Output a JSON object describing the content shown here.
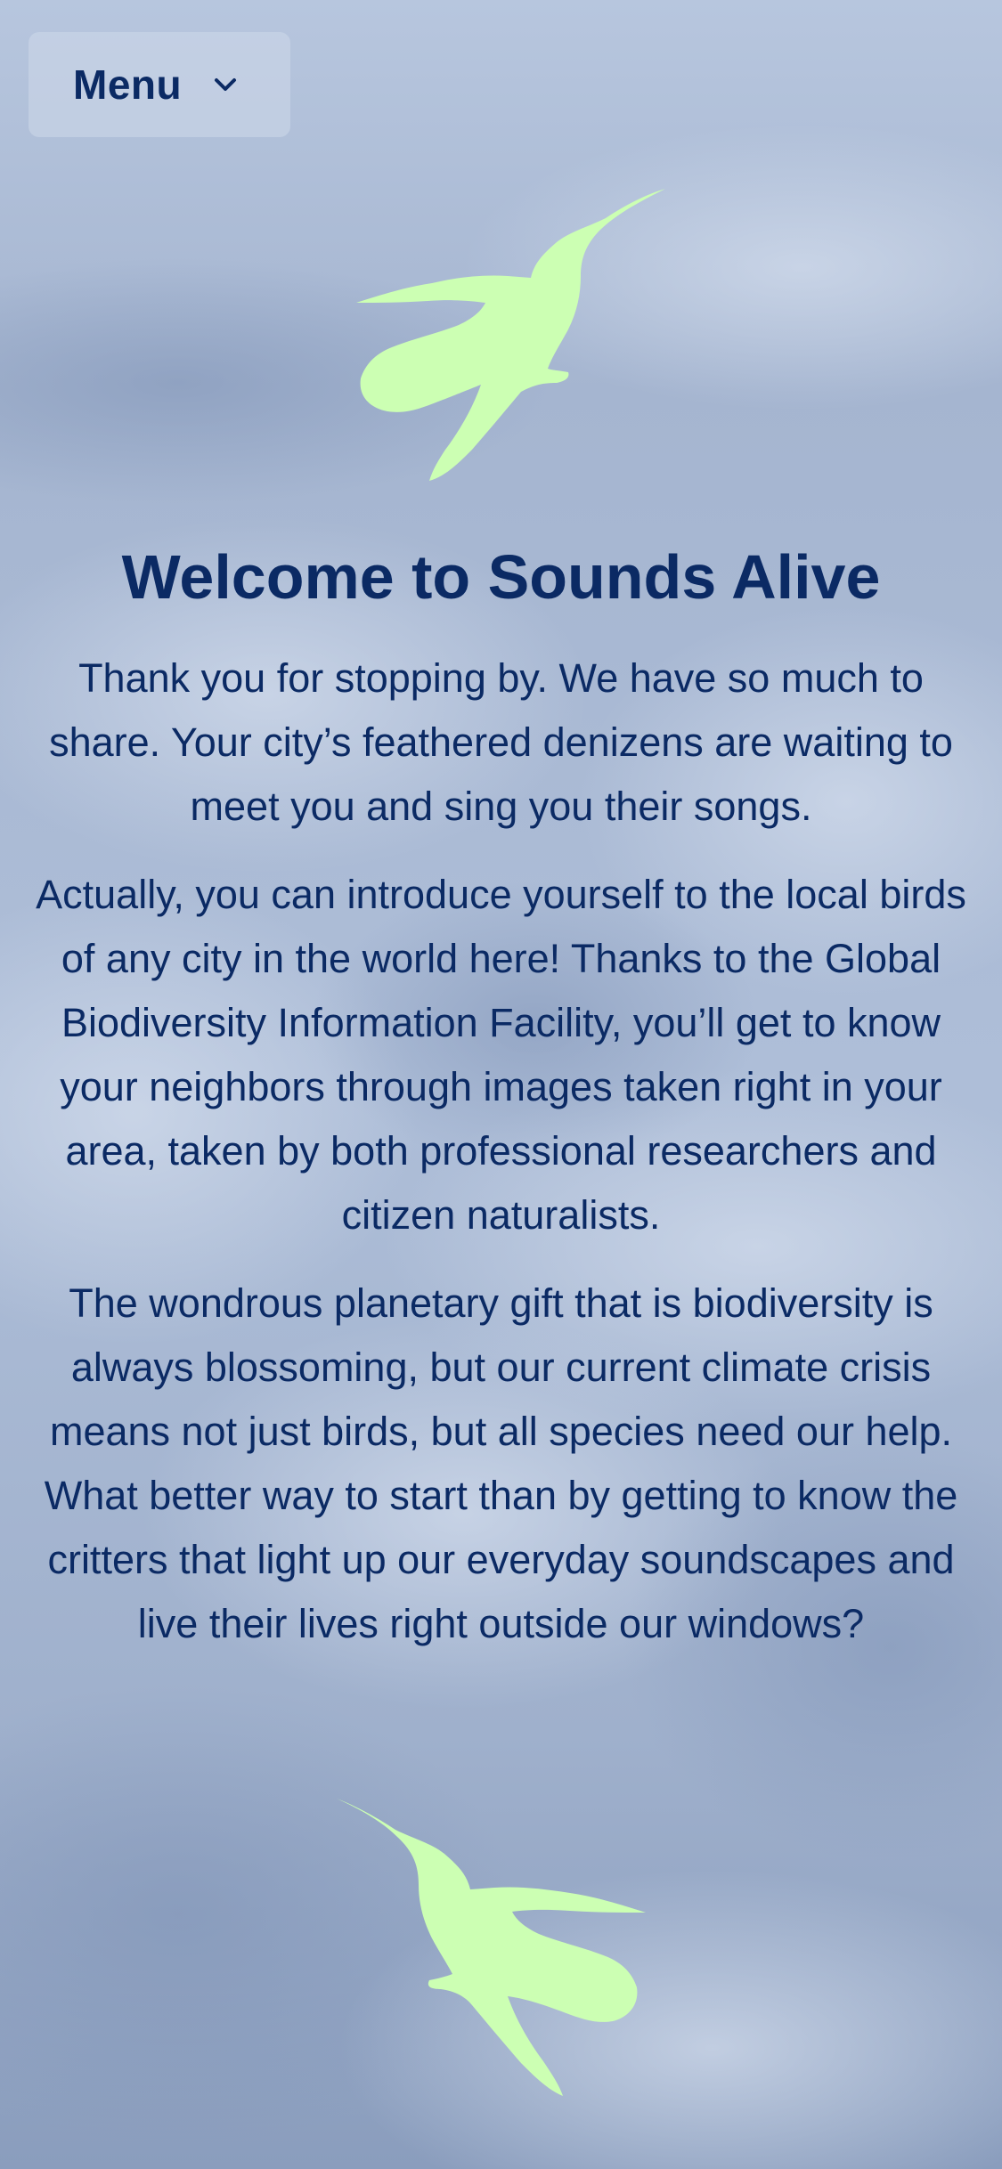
{
  "menu": {
    "label": "Menu",
    "chevron_icon": "chevron-down-icon"
  },
  "hero": {
    "title": "Welcome to Sounds Alive",
    "paragraphs": [
      "Thank you for stopping by. We have so much to share. Your city’s feathered denizens are waiting to meet you and sing you their songs.",
      "Actually, you can introduce yourself to the local birds of any city in the world here! Thanks to the Global Biodiversity Information Facility, you’ll get to know your neighbors through images taken right in your area, taken by both professional researchers and citizen naturalists.",
      "The wondrous planetary gift that is biodiversity is always blossoming, but our current climate crisis means not just birds, but all species need our help. What better way to start than by getting to know the critters that light up our everyday soundscapes and live their lives right outside our windows?"
    ]
  },
  "decor": {
    "top_icon": "hummingbird-icon",
    "bottom_icon": "hummingbird-icon"
  },
  "colors": {
    "text": "#0b2a64",
    "bird": "#ccffb3",
    "sky": "#a9bbd6"
  }
}
